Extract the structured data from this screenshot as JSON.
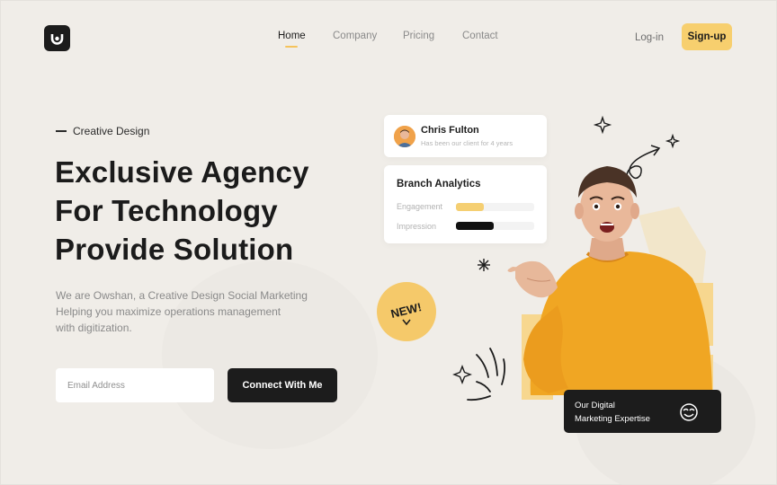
{
  "nav": {
    "items": [
      {
        "label": "Home",
        "active": true
      },
      {
        "label": "Company",
        "active": false
      },
      {
        "label": "Pricing",
        "active": false
      },
      {
        "label": "Contact",
        "active": false
      }
    ],
    "login_label": "Log-in",
    "signup_label": "Sign-up"
  },
  "hero": {
    "eyebrow": "Creative Design",
    "headline_line1": "Exclusive Agency",
    "headline_line2_prefix": "For ",
    "headline_line2_highlight": "Technology",
    "headline_line3": "Provide Solution",
    "desc_line1": "We are Owshan, a Creative Design Social Marketing",
    "desc_line2": "Helping you maximize operations management",
    "desc_line3": "with digitization.",
    "email_placeholder": "Email Address",
    "cta_label": "Connect With Me"
  },
  "client_card": {
    "name": "Chris Fulton",
    "subtitle": "Has been our client for 4 years"
  },
  "analytics_card": {
    "title": "Branch Analytics",
    "metrics": [
      {
        "label": "Engagement",
        "fraction": 0.36,
        "color": "#f5cf72"
      },
      {
        "label": "Impression",
        "fraction": 0.48,
        "color": "#111111"
      }
    ]
  },
  "badge": {
    "label": "NEW!"
  },
  "expertise_card": {
    "line1": "Our Digital",
    "line2": "Marketing Expertise"
  },
  "colors": {
    "accent": "#f5c35c",
    "background": "#f0ede8",
    "dark": "#1c1c1c",
    "sweater": "#f0a623"
  }
}
